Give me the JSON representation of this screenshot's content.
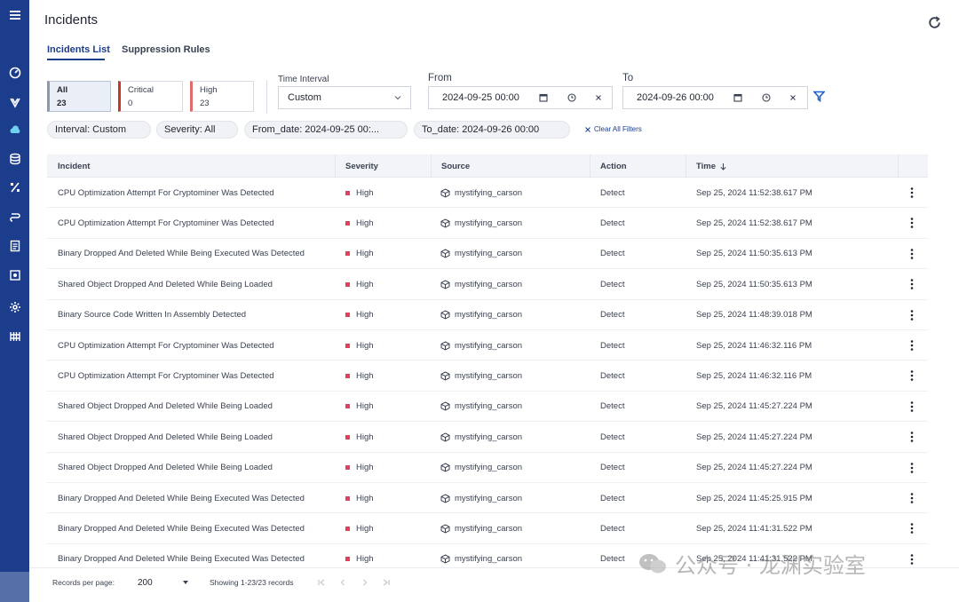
{
  "page": {
    "title": "Incidents"
  },
  "tabs": [
    {
      "label": "Incidents List",
      "active": true
    },
    {
      "label": "Suppression Rules",
      "active": false
    }
  ],
  "severity_cards": {
    "all": {
      "label": "All",
      "count": "23"
    },
    "critical": {
      "label": "Critical",
      "count": "0"
    },
    "high": {
      "label": "High",
      "count": "23"
    }
  },
  "filters": {
    "time_interval_label": "Time Interval",
    "time_interval_value": "Custom",
    "from_label": "From",
    "from_value": "2024-09-25 00:00",
    "to_label": "To",
    "to_value": "2024-09-26 00:00"
  },
  "chips": {
    "interval": "Interval: Custom",
    "severity": "Severity: All",
    "from_date": "From_date: 2024-09-25 00:...",
    "to_date": "To_date: 2024-09-26 00:00",
    "clear_all": "Clear All Filters"
  },
  "table": {
    "columns": [
      "Incident",
      "Severity",
      "Source",
      "Action",
      "Time"
    ],
    "sort_column": "Time",
    "sort_direction": "desc",
    "rows": [
      {
        "incident": "CPU Optimization Attempt For Cryptominer Was Detected",
        "severity": "High",
        "source": "mystifying_carson",
        "action": "Detect",
        "time": "Sep 25, 2024 11:52:38.617 PM"
      },
      {
        "incident": "CPU Optimization Attempt For Cryptominer Was Detected",
        "severity": "High",
        "source": "mystifying_carson",
        "action": "Detect",
        "time": "Sep 25, 2024 11:52:38.617 PM"
      },
      {
        "incident": "Binary Dropped And Deleted While Being Executed Was Detected",
        "severity": "High",
        "source": "mystifying_carson",
        "action": "Detect",
        "time": "Sep 25, 2024 11:50:35.613 PM"
      },
      {
        "incident": "Shared Object Dropped And Deleted While Being Loaded",
        "severity": "High",
        "source": "mystifying_carson",
        "action": "Detect",
        "time": "Sep 25, 2024 11:50:35.613 PM"
      },
      {
        "incident": "Binary Source Code Written In Assembly Detected",
        "severity": "High",
        "source": "mystifying_carson",
        "action": "Detect",
        "time": "Sep 25, 2024 11:48:39.018 PM"
      },
      {
        "incident": "CPU Optimization Attempt For Cryptominer Was Detected",
        "severity": "High",
        "source": "mystifying_carson",
        "action": "Detect",
        "time": "Sep 25, 2024 11:46:32.116 PM"
      },
      {
        "incident": "CPU Optimization Attempt For Cryptominer Was Detected",
        "severity": "High",
        "source": "mystifying_carson",
        "action": "Detect",
        "time": "Sep 25, 2024 11:46:32.116 PM"
      },
      {
        "incident": "Shared Object Dropped And Deleted While Being Loaded",
        "severity": "High",
        "source": "mystifying_carson",
        "action": "Detect",
        "time": "Sep 25, 2024 11:45:27.224 PM"
      },
      {
        "incident": "Shared Object Dropped And Deleted While Being Loaded",
        "severity": "High",
        "source": "mystifying_carson",
        "action": "Detect",
        "time": "Sep 25, 2024 11:45:27.224 PM"
      },
      {
        "incident": "Shared Object Dropped And Deleted While Being Loaded",
        "severity": "High",
        "source": "mystifying_carson",
        "action": "Detect",
        "time": "Sep 25, 2024 11:45:27.224 PM"
      },
      {
        "incident": "Binary Dropped And Deleted While Being Executed Was Detected",
        "severity": "High",
        "source": "mystifying_carson",
        "action": "Detect",
        "time": "Sep 25, 2024 11:45:25.915 PM"
      },
      {
        "incident": "Binary Dropped And Deleted While Being Executed Was Detected",
        "severity": "High",
        "source": "mystifying_carson",
        "action": "Detect",
        "time": "Sep 25, 2024 11:41:31.522 PM"
      },
      {
        "incident": "Binary Dropped And Deleted While Being Executed Was Detected",
        "severity": "High",
        "source": "mystifying_carson",
        "action": "Detect",
        "time": "Sep 25, 2024 11:41:31.522 PM"
      }
    ]
  },
  "footer": {
    "records_per_page_label": "Records per page:",
    "records_per_page_value": "200",
    "showing": "Showing 1-23/23 records"
  },
  "watermark": {
    "text": "公众号 · 龙渊实验室"
  },
  "colors": {
    "sidebar": "#1c3c8c",
    "accent": "#1c3c8c",
    "severity_high": "#e0405c",
    "severity_critical": "#c0392b"
  },
  "icons": {
    "sidebar": [
      "menu-icon",
      "dashboard-gauge-icon",
      "shield-icon",
      "cloud-icon",
      "database-icon",
      "percent-icon",
      "link-icon",
      "report-icon",
      "camera-icon",
      "gear-icon",
      "grid-icon"
    ]
  }
}
